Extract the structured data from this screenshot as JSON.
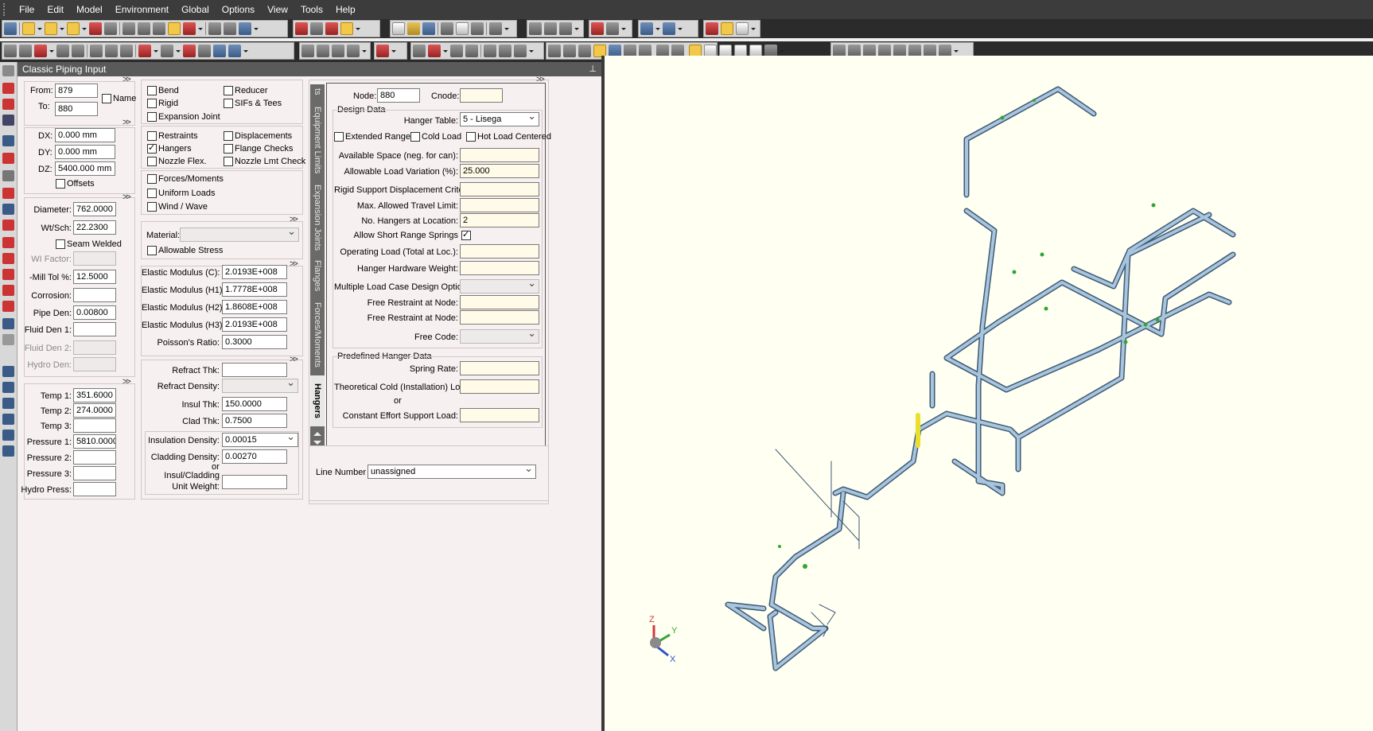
{
  "menu": [
    "File",
    "Edit",
    "Model",
    "Environment",
    "Global",
    "Options",
    "View",
    "Tools",
    "Help"
  ],
  "panel": {
    "title": "Classic Piping Input",
    "more": ">>"
  },
  "nodes": {
    "from_label": "From:",
    "from": "879",
    "to_label": "To:",
    "to": "880",
    "name_label": "Name"
  },
  "deltas": {
    "dx_label": "DX:",
    "dx": "0.000 mm",
    "dy_label": "DY:",
    "dy": "0.000 mm",
    "dz_label": "DZ:",
    "dz": "5400.000 mm",
    "offsets_label": "Offsets"
  },
  "pipe": {
    "diameter_label": "Diameter:",
    "diameter": "762.0000",
    "wt_label": "Wt/Sch:",
    "wt": "22.2300",
    "seam_label": "Seam Welded",
    "wi_label": "WI Factor:",
    "mill_label": "-Mill Tol %:",
    "mill": "12.5000",
    "corrosion_label": "Corrosion:",
    "pipeden_label": "Pipe Den:",
    "pipeden": "0.00800",
    "fluid1_label": "Fluid Den 1:",
    "fluid2_label": "Fluid Den 2:",
    "hydroden_label": "Hydro Den:"
  },
  "temps": {
    "t1_label": "Temp 1:",
    "t1": "351.6000",
    "t2_label": "Temp 2:",
    "t2": "274.0000",
    "t3_label": "Temp 3:",
    "p1_label": "Pressure 1:",
    "p1": "5810.0000",
    "p2_label": "Pressure 2:",
    "p3_label": "Pressure 3:",
    "hydro_label": "Hydro Press:"
  },
  "checks": {
    "bend": "Bend",
    "reducer": "Reducer",
    "rigid": "Rigid",
    "sifs": "SIFs & Tees",
    "expansion": "Expansion Joint",
    "restraints": "Restraints",
    "displacements": "Displacements",
    "hangers": "Hangers",
    "flange_checks": "Flange Checks",
    "nozzle_flex": "Nozzle Flex.",
    "nozzle_lmt": "Nozzle Lmt Check",
    "forces": "Forces/Moments",
    "uniform": "Uniform Loads",
    "wind": "Wind / Wave"
  },
  "material": {
    "label": "Material:",
    "allowable": "Allowable Stress"
  },
  "elastic": {
    "c_label": "Elastic Modulus (C):",
    "c": "2.0193E+008",
    "h1_label": "Elastic Modulus (H1):",
    "h1": "1.7778E+008",
    "h2_label": "Elastic Modulus (H2):",
    "h2": "1.8608E+008",
    "h3_label": "Elastic Modulus (H3):",
    "h3": "2.0193E+008",
    "poisson_label": "Poisson's Ratio:",
    "poisson": "0.3000"
  },
  "insulation": {
    "refract_thk_label": "Refract Thk:",
    "refract_den_label": "Refract Density:",
    "insul_thk_label": "Insul Thk:",
    "insul_thk": "150.0000",
    "clad_thk_label": "Clad Thk:",
    "clad_thk": "0.7500",
    "insul_den_label": "Insulation Density:",
    "insul_den": "0.00015",
    "clad_den_label": "Cladding Density:",
    "clad_den": "0.00270",
    "or": "or",
    "unit_wt_label_1": "Insul/Cladding",
    "unit_wt_label_2": "Unit Weight:"
  },
  "tabs": [
    "Equipment Limits",
    "Expansion Joints",
    "Flanges",
    "Forces/Moments",
    "Hangers"
  ],
  "tab_partial": "ts",
  "hanger": {
    "node_label": "Node:",
    "node": "880",
    "cnode_label": "Cnode:",
    "design_data": "Design Data",
    "table_label": "Hanger Table:",
    "table": "5 -  Lisega",
    "extended_range": "Extended Range",
    "cold_load": "Cold Load",
    "hot_centered": "Hot Load Centered",
    "avail_space_label": "Available Space (neg. for can):",
    "allow_var_label": "Allowable Load Variation (%):",
    "allow_var": "25.000",
    "rigid_disp_label": "Rigid Support Displacement Criteria:",
    "max_travel_label": "Max. Allowed Travel Limit:",
    "num_hangers_label": "No. Hangers at Location:",
    "num_hangers": "2",
    "short_range_label": "Allow Short Range Springs",
    "op_load_label": "Operating Load (Total at Loc.):",
    "hardware_label": "Hanger Hardware Weight:",
    "multi_lc_label": "Multiple Load Case Design Option:",
    "free_restr1_label": "Free Restraint at Node:",
    "free_restr2_label": "Free Restraint at Node:",
    "free_code_label": "Free Code:",
    "predefined": "Predefined Hanger Data",
    "spring_rate_label": "Spring Rate:",
    "theo_cold_label": "Theoretical Cold (Installation) Load:",
    "or": "or",
    "const_effort_label": "Constant Effort Support Load:"
  },
  "line": {
    "label": "Line Number :",
    "value": "unassigned"
  },
  "axes": {
    "z": "Z",
    "y": "Y",
    "x": "X"
  },
  "colors": {
    "pipe": "#a9c4dd",
    "pipe_edge": "#3e5a74",
    "highlight": "#e8e02a",
    "restraint": "#2fa82f"
  }
}
